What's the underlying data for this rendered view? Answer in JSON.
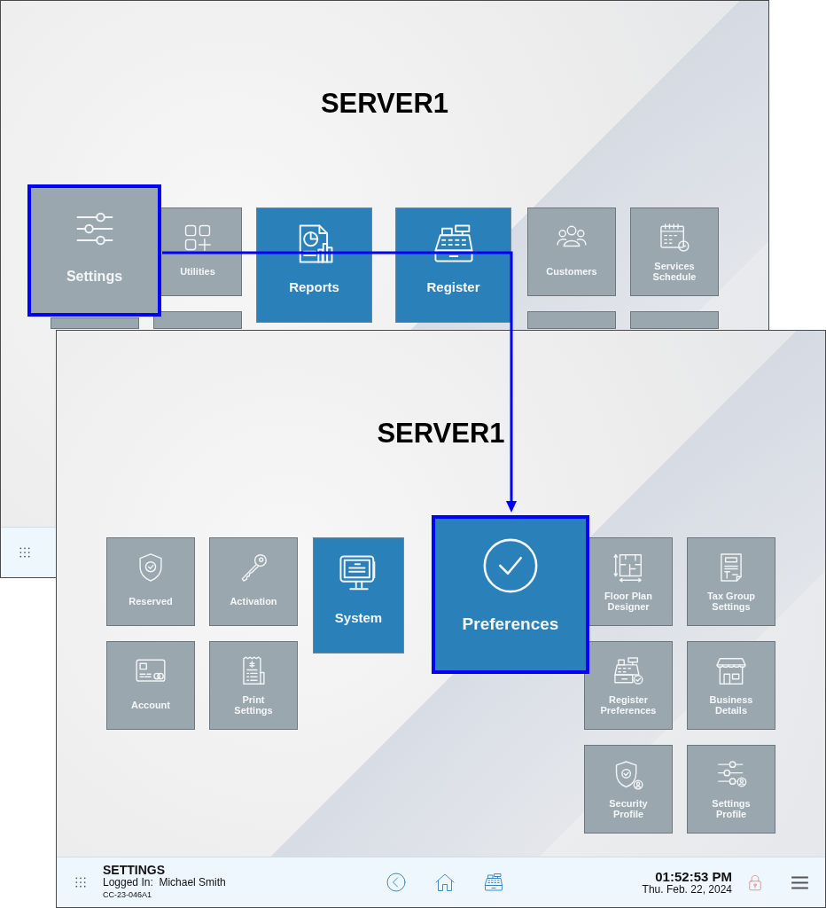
{
  "back_window": {
    "title": "SERVER1",
    "tile_groups": [
      {
        "tiles": [
          {
            "label": "Settings",
            "kind": "secondary",
            "highlighted": true
          },
          {
            "label": "Utilities",
            "kind": "secondary",
            "highlighted": false
          },
          {
            "kind": "secondary",
            "highlighted": false
          },
          {
            "kind": "secondary",
            "highlighted": false
          }
        ]
      },
      {
        "tiles": [
          {
            "label": "Reports",
            "kind": "primary",
            "highlighted": false
          },
          {
            "label": "Register",
            "kind": "primary",
            "highlighted": false
          }
        ]
      },
      {
        "tiles": [
          {
            "label": "Customers",
            "kind": "secondary",
            "highlighted": false
          },
          {
            "label": "Services Schedule",
            "kind": "secondary",
            "highlighted": false
          },
          {
            "kind": "secondary",
            "highlighted": false
          },
          {
            "kind": "secondary",
            "highlighted": false
          }
        ]
      }
    ]
  },
  "front_window": {
    "title": "SERVER1",
    "tile_groups": [
      {
        "tiles": [
          {
            "label": "Reserved",
            "kind": "secondary",
            "highlighted": false
          },
          {
            "label": "Activation",
            "kind": "secondary",
            "highlighted": false
          },
          {
            "label": "Account",
            "kind": "secondary",
            "highlighted": false
          },
          {
            "label": "Print Settings",
            "kind": "secondary",
            "highlighted": false
          }
        ]
      },
      {
        "tiles": [
          {
            "label": "System",
            "kind": "primary",
            "highlighted": false
          },
          {
            "label": "Preferences",
            "kind": "primary",
            "highlighted": true
          }
        ]
      },
      {
        "tiles": [
          {
            "label": "Floor Plan Designer",
            "kind": "secondary",
            "highlighted": false
          },
          {
            "label": "Tax Group Settings",
            "kind": "secondary",
            "highlighted": false
          },
          {
            "label": "Register Preferences",
            "kind": "secondary",
            "highlighted": false
          },
          {
            "label": "Business Details",
            "kind": "secondary",
            "highlighted": false
          },
          {
            "label": "Security Profile",
            "kind": "secondary",
            "highlighted": false
          },
          {
            "label": "Settings Profile",
            "kind": "secondary",
            "highlighted": false
          }
        ]
      }
    ],
    "bottom_bar": {
      "screen_title": "SETTINGS",
      "login_line": "Logged In:  Michael Smith",
      "device_id": "CC-23-046A1",
      "time": "01:52:53 PM",
      "date": "Thu. Feb. 22, 2024"
    }
  }
}
